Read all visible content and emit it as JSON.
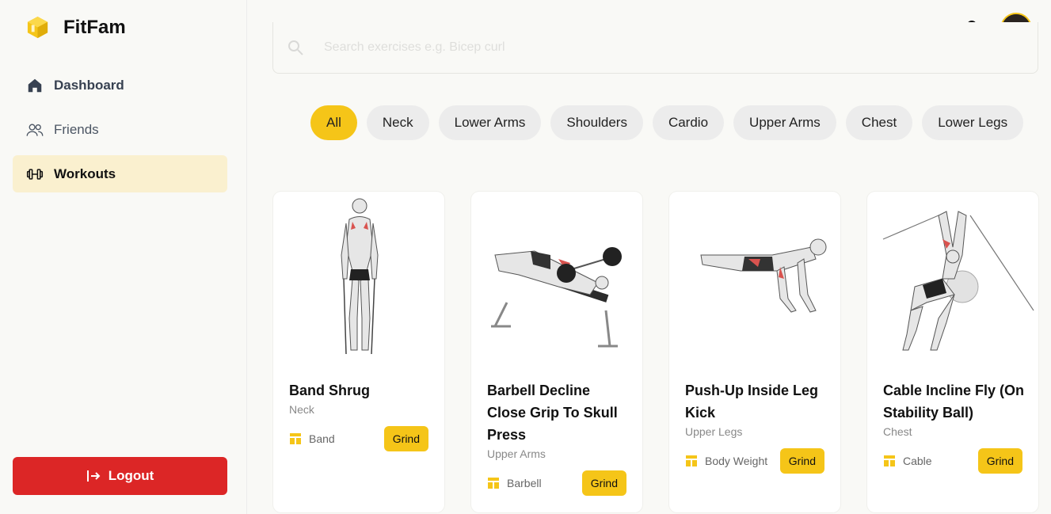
{
  "app": {
    "name": "FitFam"
  },
  "sidebar": {
    "items": [
      {
        "label": "Dashboard",
        "icon": "home-icon"
      },
      {
        "label": "Friends",
        "icon": "users-icon"
      },
      {
        "label": "Workouts",
        "icon": "dumbbell-icon"
      }
    ],
    "logout_label": "Logout"
  },
  "search": {
    "placeholder": "Search exercises e.g. Bicep curl"
  },
  "filters": {
    "chips": [
      "All",
      "Neck",
      "Lower Arms",
      "Shoulders",
      "Cardio",
      "Upper Arms",
      "Chest",
      "Lower Legs"
    ],
    "selected": "All"
  },
  "workouts": [
    {
      "title": "Band Shrug",
      "category": "Neck",
      "equipment": "Band",
      "action": "Grind"
    },
    {
      "title": "Barbell Decline Close Grip To Skull Press",
      "category": "Upper Arms",
      "equipment": "Barbell",
      "action": "Grind"
    },
    {
      "title": "Push-Up Inside Leg Kick",
      "category": "Upper Legs",
      "equipment": "Body Weight",
      "action": "Grind"
    },
    {
      "title": "Cable Incline Fly (On Stability Ball)",
      "category": "Chest",
      "equipment": "Cable",
      "action": "Grind"
    }
  ],
  "colors": {
    "accent": "#f5c518",
    "danger": "#dc2626",
    "active_bg": "#faf0cf"
  }
}
